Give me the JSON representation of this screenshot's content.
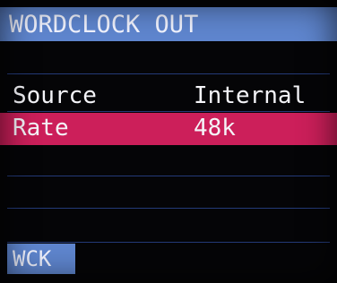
{
  "title": "WORDCLOCK OUT",
  "rows": [
    {
      "label": "Source",
      "value": "Internal",
      "selected": false
    },
    {
      "label": "Rate",
      "value": "48k",
      "selected": true
    }
  ],
  "footer_tab": "WCK",
  "colors": {
    "title_bar": "#5f86cf",
    "selection": "#cc1f5a",
    "separator": "#243a78",
    "background": "#050507"
  }
}
